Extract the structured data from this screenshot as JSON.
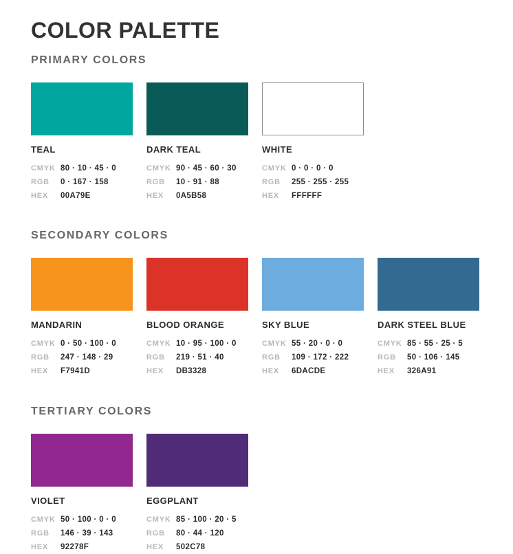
{
  "page": {
    "title": "COLOR PALETTE",
    "title_color": "#333333",
    "background": "#FFFFFF",
    "label_key_color": "#B7B7B7",
    "label_value_color": "#2B2B2B",
    "section_heading_color": "#666666"
  },
  "spec_labels": {
    "cmyk": "CMYK",
    "rgb": "RGB",
    "hex": "HEX"
  },
  "sections": [
    {
      "id": "primary",
      "title": "PRIMARY COLORS",
      "swatches": [
        {
          "name": "TEAL",
          "hex": "00A79E",
          "swatch_color": "#00A79E",
          "cmyk": "80 · 10 · 45 · 0",
          "rgb": "0 · 167 · 158",
          "bordered": false
        },
        {
          "name": "DARK TEAL",
          "hex": "0A5B58",
          "swatch_color": "#0A5B58",
          "cmyk": "90 · 45 · 60 · 30",
          "rgb": "10 · 91 · 88",
          "bordered": false
        },
        {
          "name": "WHITE",
          "hex": "FFFFFF",
          "swatch_color": "#FFFFFF",
          "cmyk": "0 · 0 · 0 · 0",
          "rgb": "255 · 255 · 255",
          "bordered": true
        }
      ]
    },
    {
      "id": "secondary",
      "title": "SECONDARY COLORS",
      "swatches": [
        {
          "name": "MANDARIN",
          "hex": "F7941D",
          "swatch_color": "#F7941D",
          "cmyk": "0 · 50 · 100 · 0",
          "rgb": "247 · 148 · 29",
          "bordered": false
        },
        {
          "name": "BLOOD ORANGE",
          "hex": "DB3328",
          "swatch_color": "#DB3328",
          "cmyk": "10 · 95 · 100 · 0",
          "rgb": "219 · 51 · 40",
          "bordered": false
        },
        {
          "name": "SKY BLUE",
          "hex": "6DACDE",
          "swatch_color": "#6DACDE",
          "cmyk": "55 · 20 · 0 · 0",
          "rgb": "109 · 172 · 222",
          "bordered": false
        },
        {
          "name": "DARK STEEL BLUE",
          "hex": "326A91",
          "swatch_color": "#326A91",
          "cmyk": "85 · 55 · 25 · 5",
          "rgb": "50 · 106 · 145",
          "bordered": false
        }
      ]
    },
    {
      "id": "tertiary",
      "title": "TERTIARY COLORS",
      "swatches": [
        {
          "name": "VIOLET",
          "hex": "92278F",
          "swatch_color": "#92278F",
          "cmyk": "50 · 100 · 0 · 0",
          "rgb": "146 · 39 · 143",
          "bordered": false
        },
        {
          "name": "EGGPLANT",
          "hex": "502C78",
          "swatch_color": "#502C78",
          "cmyk": "85 · 100 · 20 · 5",
          "rgb": "80 · 44 · 120",
          "bordered": false
        }
      ]
    }
  ]
}
